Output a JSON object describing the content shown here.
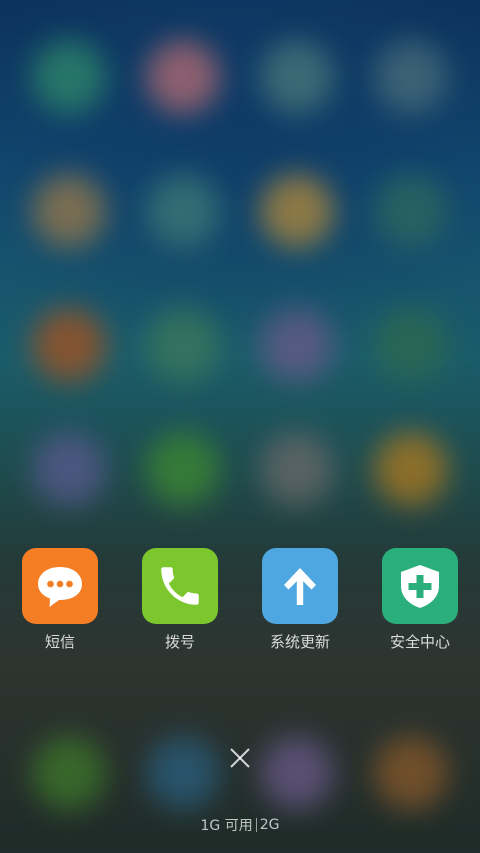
{
  "background": {
    "blurred_apps": [
      {
        "color": "#2f8a6a"
      },
      {
        "color": "#b76c72"
      },
      {
        "color": "#4a7a7a"
      },
      {
        "color": "#4a6e7a"
      },
      {
        "color": "#9a7a4a"
      },
      {
        "color": "#3f7a76"
      },
      {
        "color": "#b58a3a"
      },
      {
        "color": "#2f6a5e"
      },
      {
        "color": "#a8521e"
      },
      {
        "color": "#3d7a5a"
      },
      {
        "color": "#6a5a8a"
      },
      {
        "color": "#2e6a4e"
      },
      {
        "color": "#5a5a90"
      },
      {
        "color": "#3e8a30"
      },
      {
        "color": "#6a6a6a"
      },
      {
        "color": "#b07a1e"
      },
      {
        "color": "#3e7a2a"
      },
      {
        "color": "#2a6080"
      },
      {
        "color": "#6a5a8a"
      },
      {
        "color": "#8a5a2a"
      }
    ]
  },
  "recent_apps": [
    {
      "label": "短信",
      "icon": "message-bubble-icon",
      "color": "#f57d24"
    },
    {
      "label": "拨号",
      "icon": "phone-icon",
      "color": "#7dc72e"
    },
    {
      "label": "系统更新",
      "icon": "up-arrow-icon",
      "color": "#4ea7e0"
    },
    {
      "label": "安全中心",
      "icon": "shield-plus-icon",
      "color": "#2aaf7c"
    }
  ],
  "close": {
    "icon": "close-icon"
  },
  "memory": {
    "available": "1G 可用",
    "total": "2G"
  }
}
